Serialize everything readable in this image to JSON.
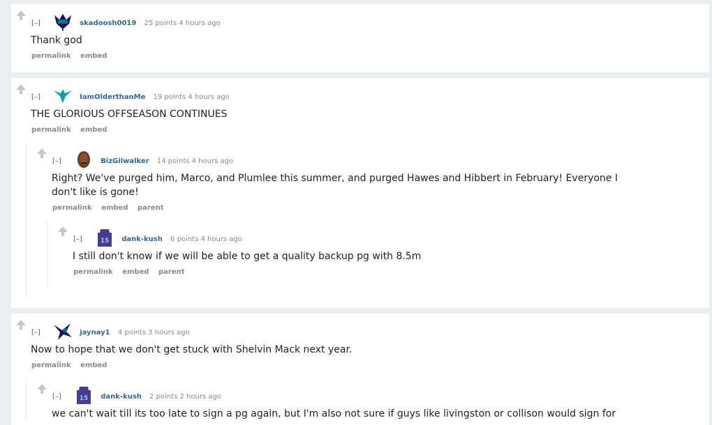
{
  "comments": [
    {
      "collapse": "[–]",
      "author": "skadoosh0019",
      "meta": "25 points 4 hours ago",
      "body": "Thank god",
      "buttons": [
        "permalink",
        "embed"
      ],
      "flair": "hornets-logo-icon"
    },
    {
      "collapse": "[–]",
      "author": "IamOlderthanMe",
      "meta": "19 points 4 hours ago",
      "body": "THE GLORIOUS OFFSEASON CONTINUES",
      "buttons": [
        "permalink",
        "embed"
      ],
      "flair": "hornet-teal-icon"
    },
    {
      "collapse": "[–]",
      "author": "BizGilwalker",
      "meta": "14 points 4 hours ago",
      "body": "Right? We've purged him, Marco, and Plumlee this summer, and purged Hawes and Hibbert in February! Everyone I don't like is gone!",
      "buttons": [
        "permalink",
        "embed",
        "parent"
      ],
      "flair": "face-avatar-icon"
    },
    {
      "collapse": "[–]",
      "author": "dank-kush",
      "meta": "6 points 4 hours ago",
      "body": "I still don't know if we will be able to get a quality backup pg with 8.5m",
      "buttons": [
        "permalink",
        "embed",
        "parent"
      ],
      "flair": "jersey-15-icon"
    },
    {
      "collapse": "[–]",
      "author": "jaynay1",
      "meta": "4 points 3 hours ago",
      "body": "Now to hope that we don't get stuck with Shelvin Mack next year.",
      "buttons": [
        "permalink",
        "embed"
      ],
      "flair": "hornet-navy-icon"
    },
    {
      "collapse": "[–]",
      "author": "dank-kush",
      "meta": "2 points 2 hours ago",
      "body": "we can't wait till its too late to sign a pg again, but I'm also not sure if guys like livingston or collison would sign for",
      "buttons": [],
      "flair": "jersey-15-icon"
    }
  ],
  "colors": {
    "background": "#e9eef0",
    "author": "#336699",
    "meta": "#888888"
  }
}
